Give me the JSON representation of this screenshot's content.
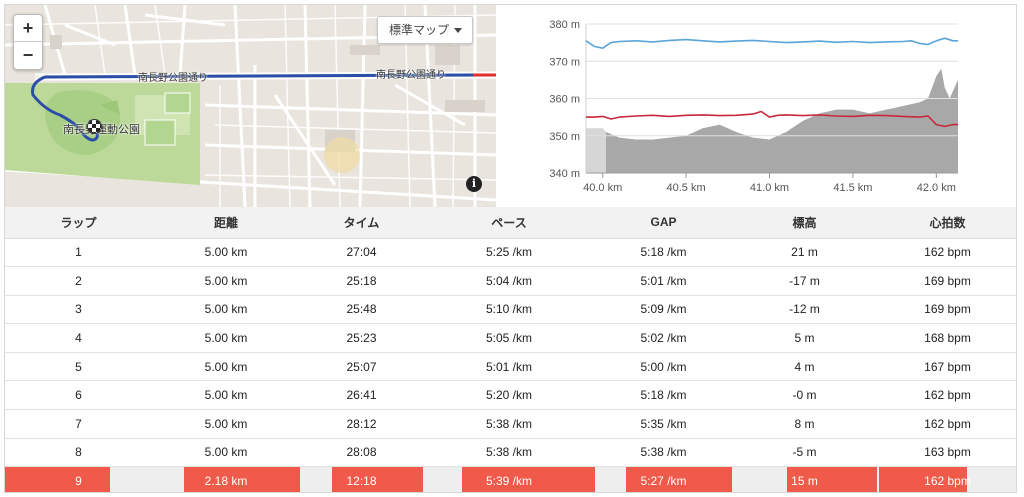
{
  "map": {
    "zoom_in": "+",
    "zoom_out": "−",
    "map_type": "標準マップ",
    "road_label_1": "南長野公園通り",
    "road_label_2": "南長野公園通り",
    "park_label": "南長野運動公園",
    "info": "i",
    "colors": {
      "route": "#2b4fa8",
      "route_end": "#e03030",
      "park": "#bcd99a",
      "road": "#ffffff",
      "land": "#e8e3dc"
    }
  },
  "chart_data": {
    "type": "line",
    "xlabel": "",
    "ylabel": "",
    "x_ticks": [
      "40.0 km",
      "40.5 km",
      "41.0 km",
      "41.5 km",
      "42.0 km"
    ],
    "x_tick_values": [
      40.0,
      40.5,
      41.0,
      41.5,
      42.0
    ],
    "y_ticks": [
      "340 m",
      "350 m",
      "360 m",
      "370 m",
      "380 m"
    ],
    "y_tick_values": [
      340,
      350,
      360,
      370,
      380
    ],
    "xlim": [
      39.9,
      42.13
    ],
    "ylim": [
      340,
      380
    ],
    "grid": true,
    "series": [
      {
        "kind": "area",
        "color": "#a8a8a8",
        "x": [
          39.9,
          40.0,
          40.02,
          40.1,
          40.2,
          40.3,
          40.4,
          40.5,
          40.6,
          40.7,
          40.75,
          40.8,
          40.9,
          41.0,
          41.1,
          41.2,
          41.3,
          41.4,
          41.5,
          41.6,
          41.7,
          41.8,
          41.9,
          41.95,
          42.0,
          42.03,
          42.05,
          42.08,
          42.1,
          42.13
        ],
        "values": [
          352,
          352,
          351,
          349.5,
          349,
          349,
          349.5,
          350,
          352,
          353,
          352,
          351,
          349.5,
          349,
          351,
          354,
          356,
          357,
          357,
          356,
          357,
          358,
          359,
          360,
          366,
          368,
          363,
          360,
          362,
          365
        ]
      },
      {
        "kind": "line",
        "color": "#5aa4d9",
        "x": [
          39.9,
          39.95,
          40.0,
          40.05,
          40.1,
          40.2,
          40.3,
          40.4,
          40.5,
          40.6,
          40.7,
          40.8,
          40.9,
          41.0,
          41.1,
          41.2,
          41.3,
          41.4,
          41.5,
          41.6,
          41.7,
          41.8,
          41.85,
          41.9,
          41.95,
          42.0,
          42.05,
          42.1,
          42.13
        ],
        "values": [
          375.5,
          374,
          373.5,
          375,
          375.3,
          375.5,
          375.2,
          375.6,
          375.8,
          375.5,
          375.2,
          375.4,
          375.6,
          375.3,
          375,
          375.2,
          375.4,
          375.1,
          375.3,
          375,
          375.2,
          375.3,
          375.5,
          374.8,
          374.5,
          375.5,
          376.2,
          375.5,
          375.5
        ]
      },
      {
        "kind": "line",
        "color": "#c8283c",
        "x": [
          39.9,
          39.95,
          40.0,
          40.05,
          40.1,
          40.2,
          40.3,
          40.4,
          40.5,
          40.6,
          40.7,
          40.8,
          40.9,
          40.95,
          41.0,
          41.05,
          41.1,
          41.2,
          41.3,
          41.4,
          41.5,
          41.6,
          41.7,
          41.8,
          41.9,
          41.95,
          42.0,
          42.05,
          42.1,
          42.13
        ],
        "values": [
          355,
          355,
          355.2,
          354.5,
          355,
          355.3,
          355.5,
          355.2,
          355.5,
          355.6,
          355.4,
          355.5,
          355.8,
          356.5,
          355,
          355.5,
          355.6,
          355.4,
          355.6,
          355.3,
          355.2,
          355.5,
          355.4,
          355.2,
          355,
          355.3,
          353,
          352.5,
          353,
          353
        ]
      }
    ]
  },
  "table": {
    "headers": [
      "ラップ",
      "距離",
      "タイム",
      "ペース",
      "GAP",
      "標高",
      "心拍数"
    ],
    "rows": [
      [
        "1",
        "5.00 km",
        "27:04",
        "5:25 /km",
        "5:18 /km",
        "21 m",
        "162 bpm"
      ],
      [
        "2",
        "5.00 km",
        "25:18",
        "5:04 /km",
        "5:01 /km",
        "-17 m",
        "169 bpm"
      ],
      [
        "3",
        "5.00 km",
        "25:48",
        "5:10 /km",
        "5:09 /km",
        "-12 m",
        "169 bpm"
      ],
      [
        "4",
        "5.00 km",
        "25:23",
        "5:05 /km",
        "5:02 /km",
        "5 m",
        "168 bpm"
      ],
      [
        "5",
        "5.00 km",
        "25:07",
        "5:01 /km",
        "5:00 /km",
        "4 m",
        "167 bpm"
      ],
      [
        "6",
        "5.00 km",
        "26:41",
        "5:20 /km",
        "5:18 /km",
        "-0 m",
        "162 bpm"
      ],
      [
        "7",
        "5.00 km",
        "28:12",
        "5:38 /km",
        "5:35 /km",
        "8 m",
        "162 bpm"
      ],
      [
        "8",
        "5.00 km",
        "28:08",
        "5:38 /km",
        "5:38 /km",
        "-5 m",
        "163 bpm"
      ],
      [
        "9",
        "2.18 km",
        "12:18",
        "5:39 /km",
        "5:27 /km",
        "15 m",
        "162 bpm"
      ]
    ],
    "highlight_row": 8,
    "highlight_color": "#ef5a4a"
  }
}
